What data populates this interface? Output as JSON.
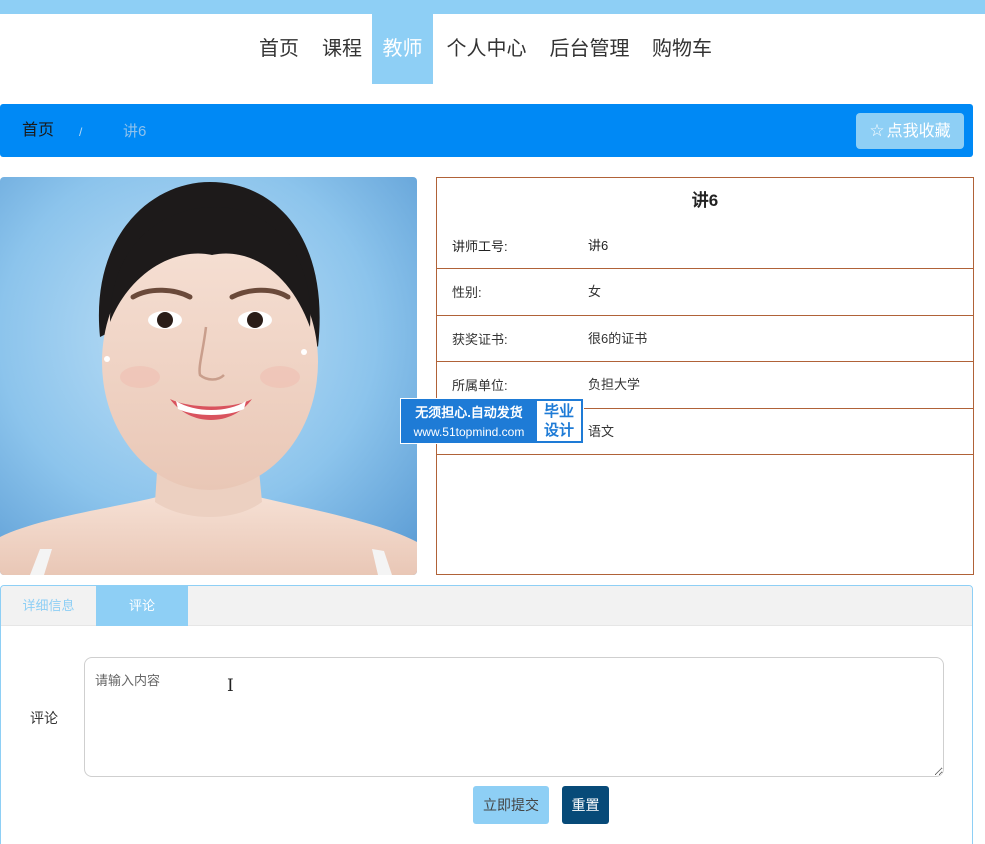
{
  "nav": {
    "items": [
      {
        "label": "首页"
      },
      {
        "label": "课程"
      },
      {
        "label": "教师"
      },
      {
        "label": "个人中心"
      },
      {
        "label": "后台管理"
      },
      {
        "label": "购物车"
      }
    ],
    "active_label": "教师"
  },
  "breadcrumb": {
    "home": "首页",
    "separator": "/",
    "current": "讲6"
  },
  "favorite_button": {
    "label": "点我收藏",
    "icon": "star-outline-icon"
  },
  "teacher": {
    "name": "讲6",
    "photo": "teacher-portrait",
    "fields": [
      {
        "label": "讲师工号:",
        "value": "讲6"
      },
      {
        "label": "性别:",
        "value": "女"
      },
      {
        "label": "获奖证书:",
        "value": "很6的证书"
      },
      {
        "label": "所属单位:",
        "value": "负担大学"
      },
      {
        "label": "",
        "value": "语文"
      }
    ]
  },
  "watermark": {
    "line1": "无须担心.自动发货",
    "line2": "www.51topmind.com",
    "badge_line1": "毕业",
    "badge_line2": "设计"
  },
  "tabs": [
    {
      "label": "详细信息"
    },
    {
      "label": "评论"
    }
  ],
  "active_tab": "评论",
  "comment_form": {
    "label": "评论",
    "placeholder": "请输入内容",
    "value": "",
    "submit_label": "立即提交",
    "reset_label": "重置"
  },
  "colors": {
    "accent_light": "#8ecff5",
    "breadcrumb_blue": "#0089f5",
    "info_border": "#b06238",
    "reset_dark": "#074a78",
    "watermark_blue": "#1e7bd6"
  }
}
